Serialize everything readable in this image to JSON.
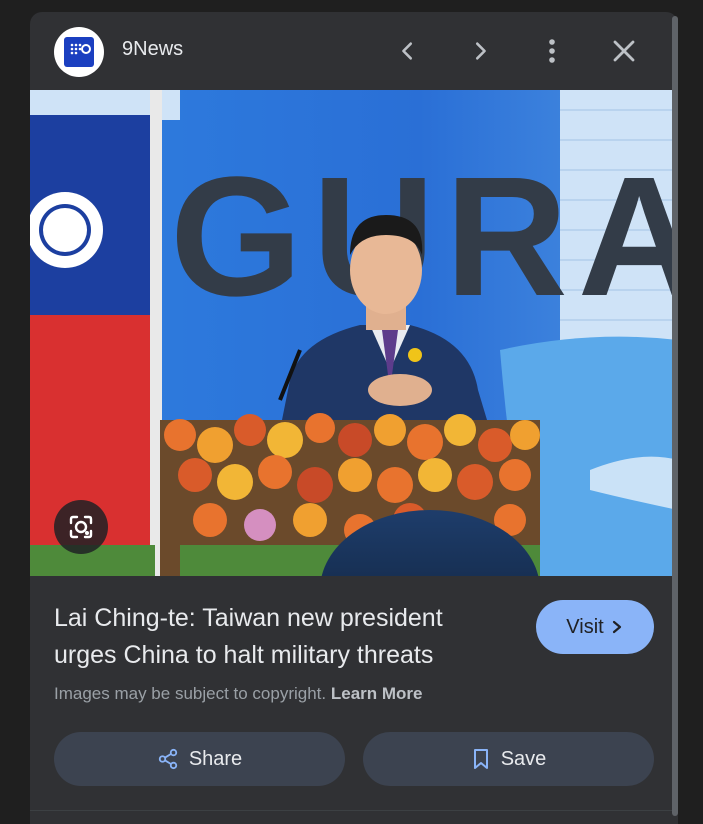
{
  "header": {
    "source_name": "9News",
    "logo_text": "9NEWS",
    "icons": [
      "chevron-left-icon",
      "chevron-right-icon",
      "more-vert-icon",
      "close-icon"
    ]
  },
  "image": {
    "backdrop_text": "GURA",
    "lens_icon": "lens-icon"
  },
  "result": {
    "title": "Lai Ching-te: Taiwan new president urges China to halt military threats",
    "visit_label": "Visit"
  },
  "copyright": {
    "text": "Images may be subject to copyright.",
    "learn_more": "Learn More"
  },
  "actions": {
    "share_label": "Share",
    "save_label": "Save"
  },
  "colors": {
    "panel_bg": "#303134",
    "page_bg": "#1f1f1f",
    "accent": "#8ab4f8",
    "button_bg": "#3c4350"
  }
}
